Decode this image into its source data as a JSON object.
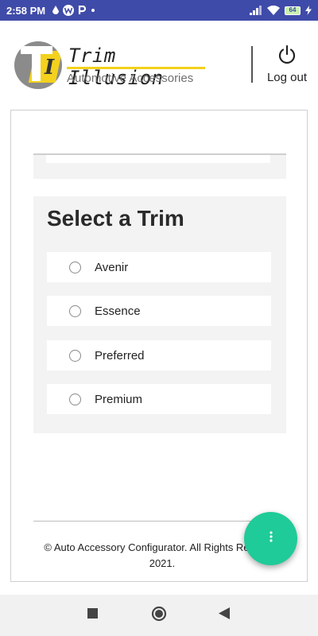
{
  "status_bar": {
    "time": "2:58 PM",
    "battery_level": "64",
    "icons": [
      "drop-icon",
      "w-app-icon",
      "p-app-icon",
      "dot-icon",
      "signal-icon",
      "wifi-icon",
      "battery-icon",
      "charging-icon"
    ]
  },
  "header": {
    "logo_title": "Trim Illusion",
    "logo_subtitle": "Automotive Accessories",
    "logo_letter": "I",
    "logout_label": "Log out"
  },
  "trim_section": {
    "title": "Select a Trim",
    "options": [
      {
        "label": "Avenir",
        "selected": false
      },
      {
        "label": "Essence",
        "selected": false
      },
      {
        "label": "Preferred",
        "selected": false
      },
      {
        "label": "Premium",
        "selected": false
      }
    ]
  },
  "footer": {
    "copyright": "© Auto Accessory Configurator. All Rights Reserved 2021."
  },
  "fab": {
    "icon": "more-vertical-icon"
  },
  "nav_bar": {
    "icons": [
      "recents-square-icon",
      "home-circle-icon",
      "back-triangle-icon"
    ]
  },
  "colors": {
    "status_bar": "#3f4ba8",
    "accent_yellow": "#f3d11d",
    "fab": "#1fcb98",
    "section_bg": "#f3f3f3"
  }
}
